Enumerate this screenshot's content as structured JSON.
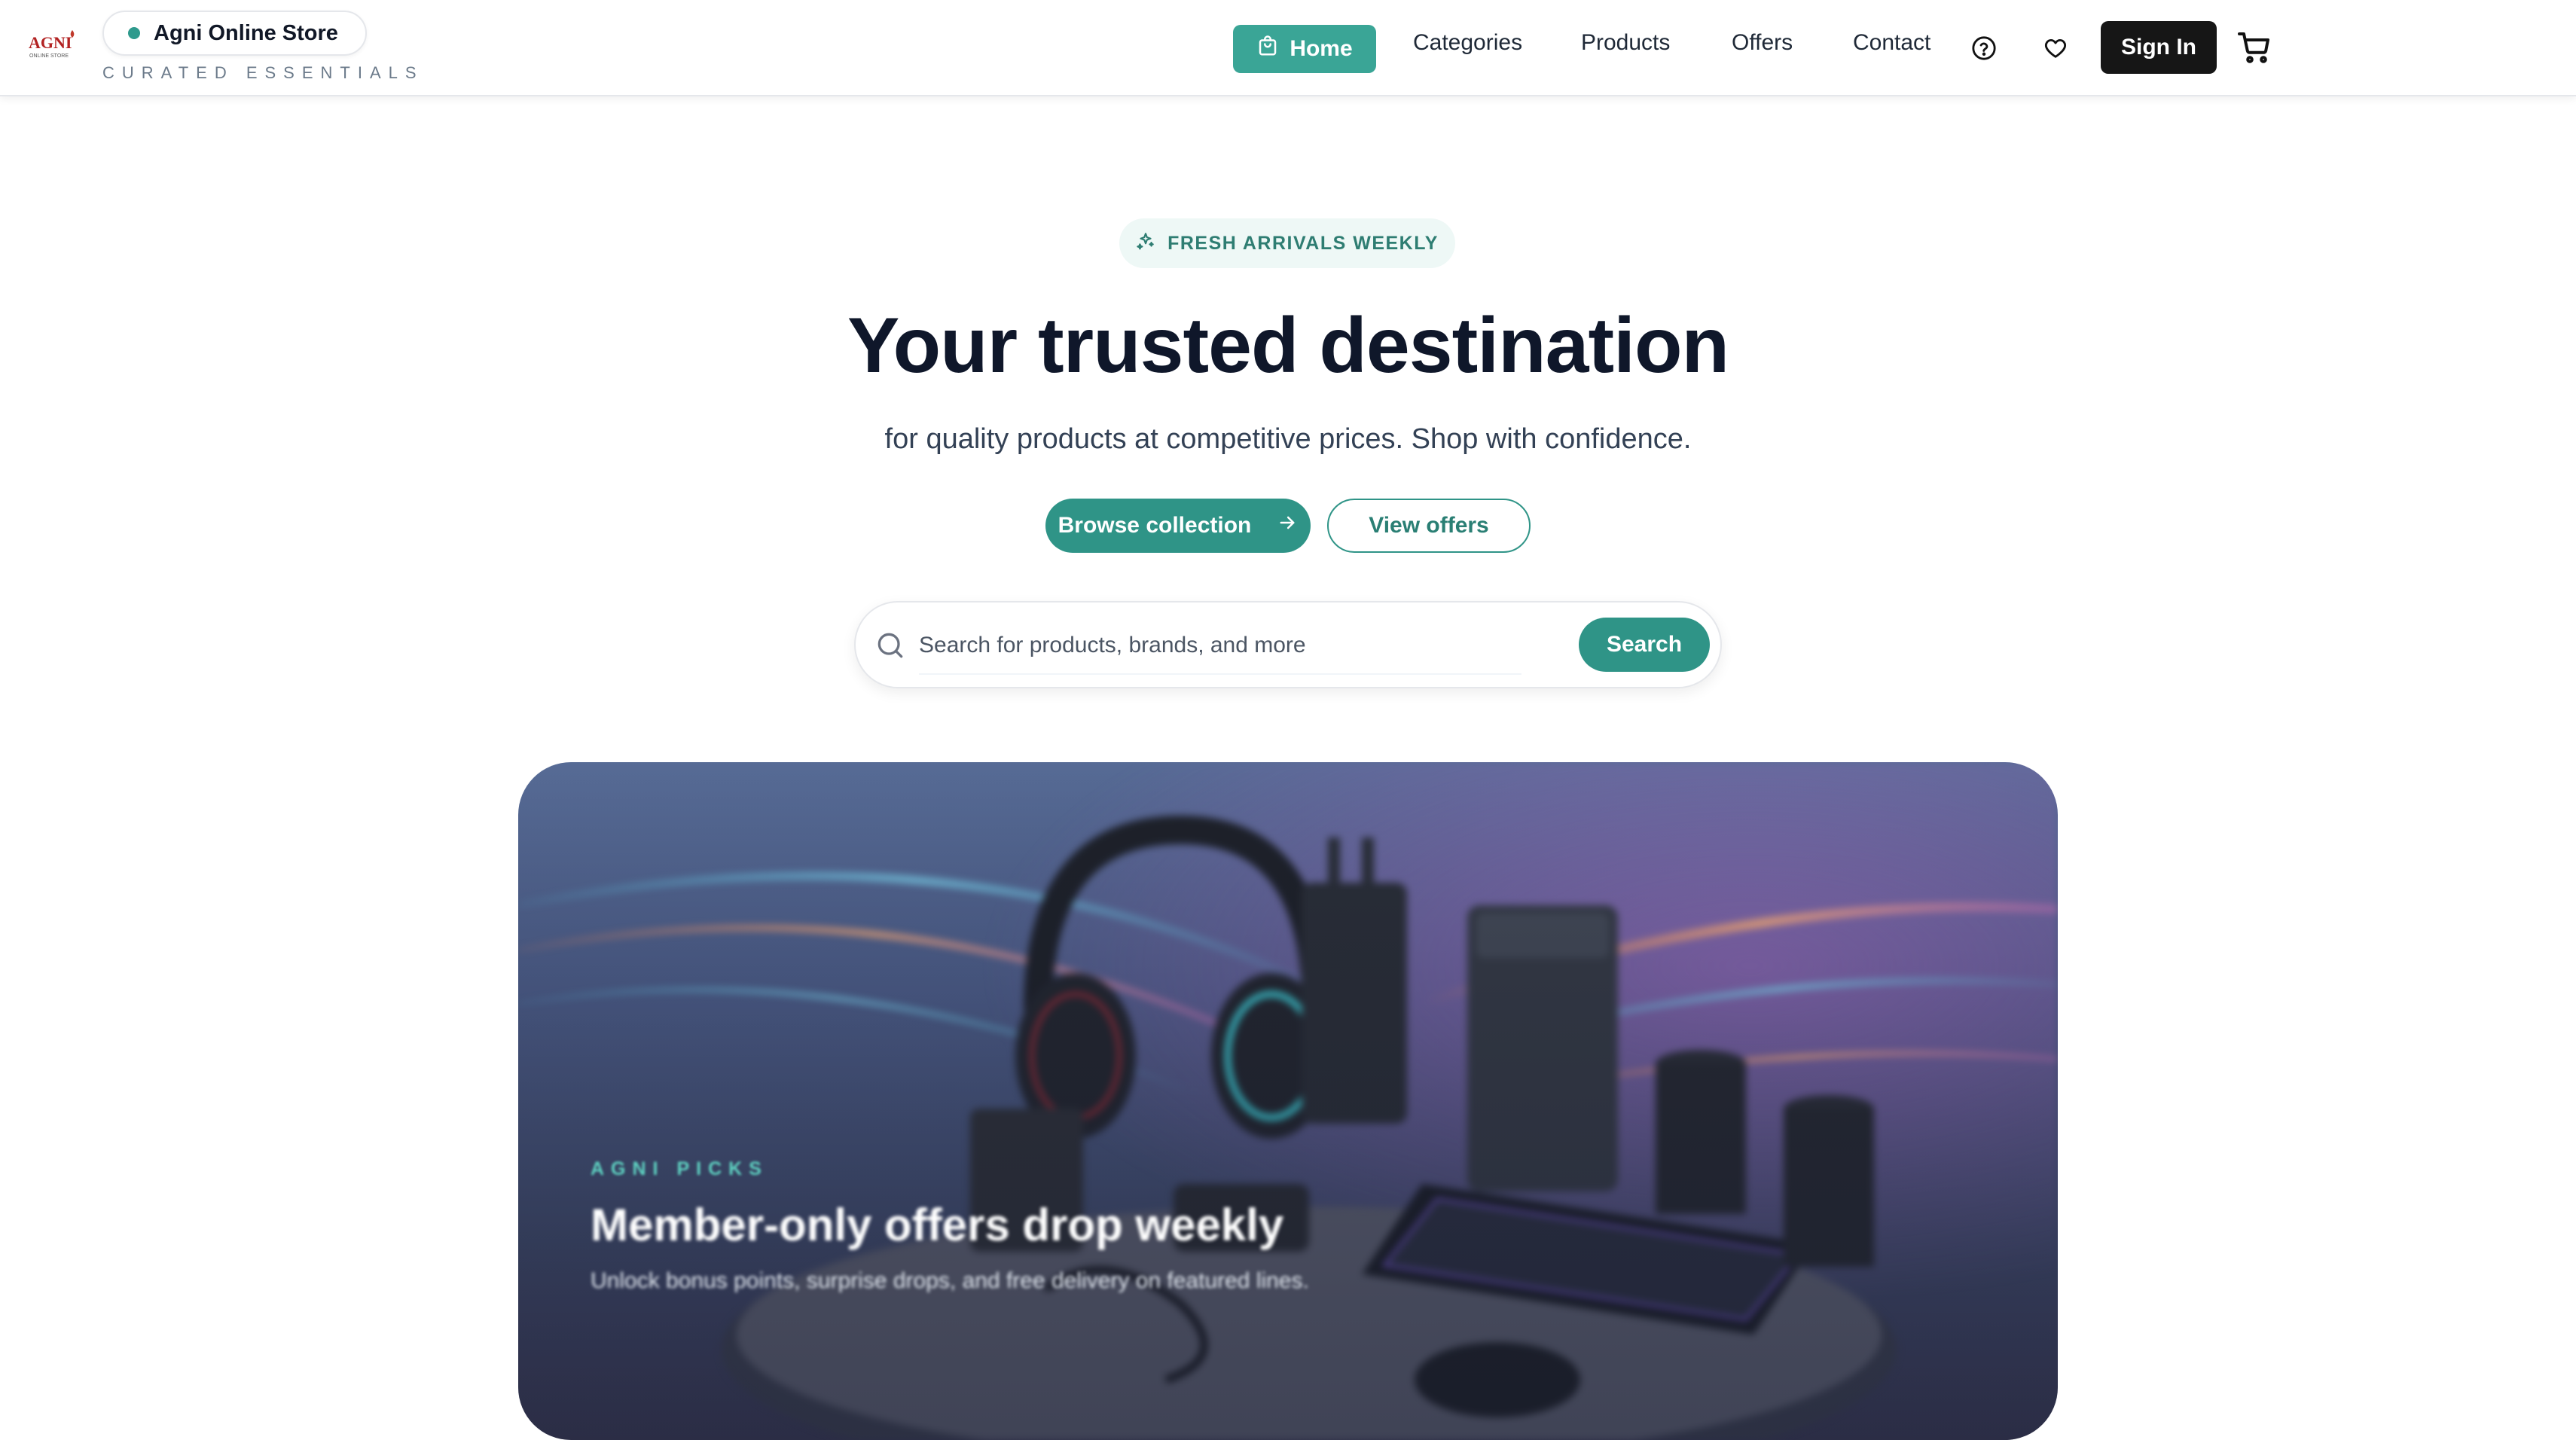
{
  "header": {
    "logo_text": "AGNI",
    "logo_subtext": "ONLINE STORE",
    "brand_name": "Agni Online Store",
    "brand_tagline": "CURATED ESSENTIALS",
    "nav": {
      "home": "Home",
      "categories": "Categories",
      "products": "Products",
      "offers": "Offers",
      "contact": "Contact"
    },
    "icons": {
      "home": "shopping-bag-icon",
      "help": "help-circle-icon",
      "wishlist": "heart-icon",
      "cart": "cart-icon"
    },
    "signin_label": "Sign In"
  },
  "hero": {
    "badge": "FRESH ARRIVALS WEEKLY",
    "badge_icon": "sparkles-icon",
    "title": "Your trusted destination",
    "subtitle": "for quality products at competitive prices. Shop with confidence.",
    "primary_cta": "Browse collection",
    "primary_cta_icon": "arrow-right-icon",
    "secondary_cta": "View offers"
  },
  "search": {
    "placeholder": "Search for products, brands, and more",
    "value": "",
    "button": "Search",
    "icon": "search-icon"
  },
  "banner": {
    "kicker": "AGNI PICKS",
    "title": "Member-only offers drop weekly",
    "subtitle": "Unlock bonus points, surprise drops, and free delivery on featured lines."
  },
  "colors": {
    "accent": "#2f9487",
    "accent_light": "#eef8f6",
    "nav_active": "#3aa596",
    "signin_bg": "#161616",
    "heading": "#0f172a"
  }
}
